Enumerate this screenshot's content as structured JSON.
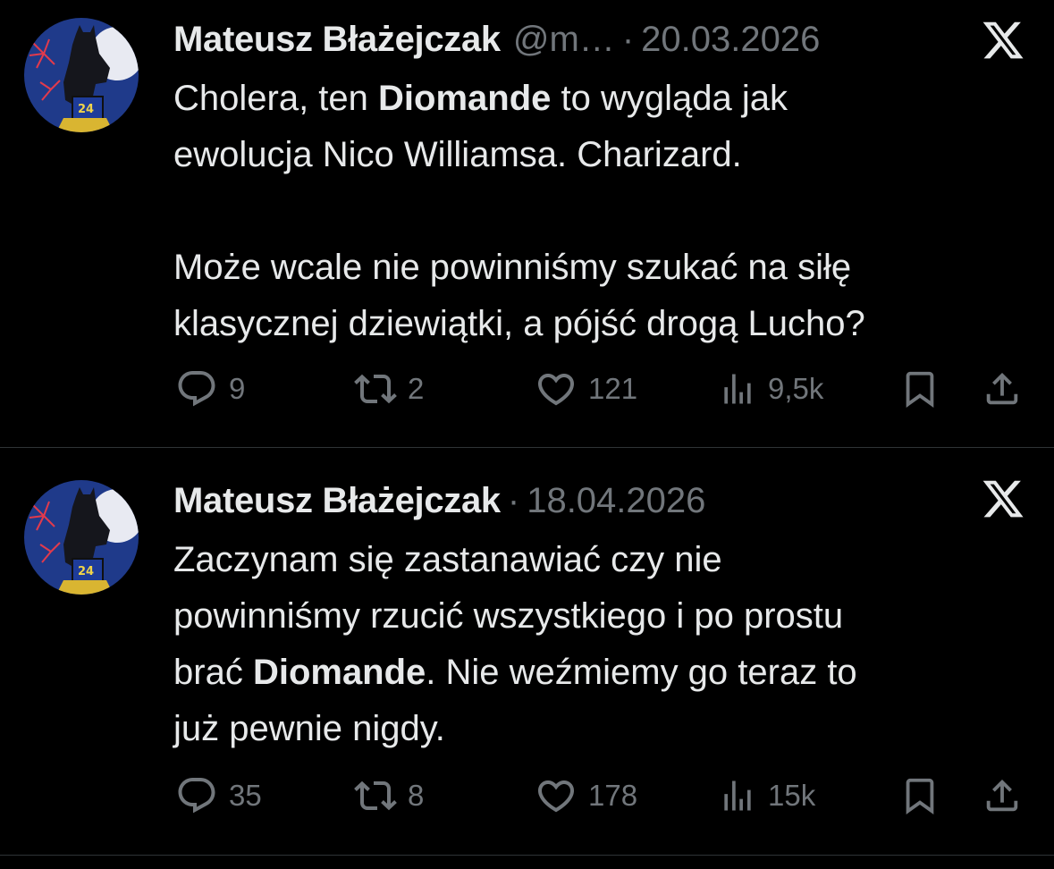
{
  "tweets": [
    {
      "author_name": "Mateusz Błażejczak",
      "handle": "@m…",
      "separator": "·",
      "date": "20.03.2026",
      "body_lines": [
        [
          "Cholera, ten ",
          "Diomande",
          " to wygląda jak"
        ],
        [
          "ewolucja Nico Williamsa. Charizard."
        ],
        [],
        [
          "Może wcale nie powinniśmy szukać na siłę"
        ],
        [
          "klasycznej dziewiątki, a pójść drogą Lucho?"
        ]
      ],
      "stats": {
        "replies": "9",
        "retweets": "2",
        "likes": "121",
        "views": "9,5k"
      }
    },
    {
      "author_name": "Mateusz Błażejczak",
      "separator": "·",
      "date": "18.04.2026",
      "body_lines": [
        [
          "Zaczynam się zastanawiać czy nie"
        ],
        [
          "powinniśmy rzucić wszystkiego i po prostu"
        ],
        [
          "brać ",
          "Diomande",
          ". Nie weźmiemy go teraz to"
        ],
        [
          "już pewnie nigdy."
        ]
      ],
      "stats": {
        "replies": "35",
        "retweets": "8",
        "likes": "178",
        "views": "15k"
      }
    }
  ],
  "avatar": {
    "jersey_number": "24",
    "colors": {
      "background": "#1f3a8a",
      "moon": "#e8eaf2",
      "figure": "#15161c",
      "fireworks": "#e23a4c",
      "rooftop": "#d9b531"
    }
  },
  "icons": {
    "platform": "x-logo-icon",
    "reply": "reply-bubble-icon",
    "retweet": "retweet-icon",
    "like": "heart-icon",
    "views": "views-bar-chart-icon",
    "bookmark": "bookmark-icon",
    "share": "share-upload-icon"
  },
  "theme": {
    "background": "#000000",
    "text_primary": "#e7e9ea",
    "text_secondary": "#71767b",
    "divider": "#2f3336"
  }
}
